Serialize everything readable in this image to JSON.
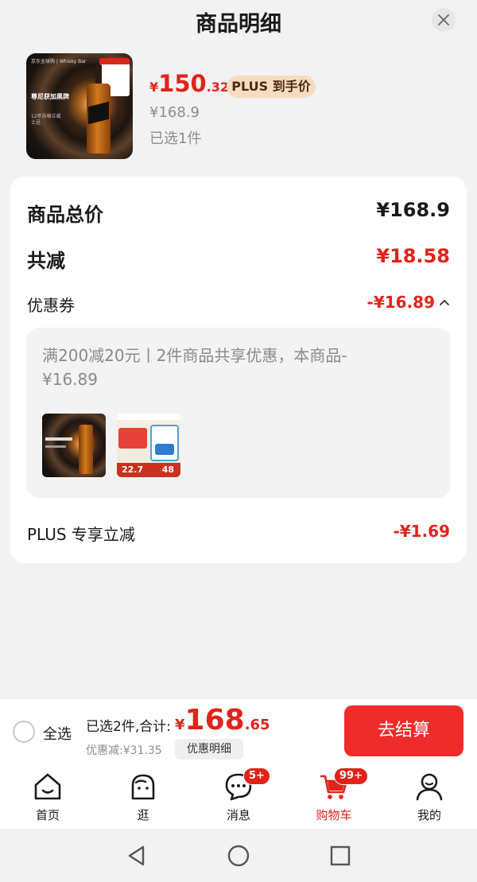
{
  "header": {
    "title": "商品明细",
    "close_icon": "close-icon"
  },
  "product": {
    "image": {
      "brand_text": "京东全球购 | Whisky Bar",
      "name_text": "尊尼获加黑牌",
      "sub_text": "12年苏格兰威士忌"
    },
    "price_currency": "¥",
    "price_int": "150",
    "price_dec": ".32",
    "plus_tag": "PLUS 到手价",
    "original_price": "¥168.9",
    "selected_count": "已选1件"
  },
  "summary": {
    "total_label": "商品总价",
    "total_value": "¥168.9",
    "reduce_label": "共减",
    "reduce_value": "¥18.58",
    "coupon_label": "优惠券",
    "coupon_value": "-¥16.89",
    "coupon_desc": "满200减20元丨2件商品共享优惠，本商品-¥16.89",
    "coupon_thumbs": [
      {
        "name": "whisky"
      },
      {
        "name": "milk-powder",
        "price_left": "22.7",
        "price_right": "48"
      }
    ],
    "plus_label": "PLUS 专享立减",
    "plus_value": "-¥1.69"
  },
  "checkout": {
    "select_all": "全选",
    "sum_prefix": "已选2件,合计:",
    "sum_currency": "¥",
    "sum_int": "168",
    "sum_dec": ".65",
    "discount_text": "优惠减:¥31.35",
    "discount_detail": "优惠明细",
    "checkout_button": "去结算"
  },
  "tabbar": {
    "items": [
      {
        "label": "首页",
        "icon": "home-icon"
      },
      {
        "label": "逛",
        "icon": "browse-icon"
      },
      {
        "label": "消息",
        "icon": "message-icon",
        "badge": "5+"
      },
      {
        "label": "购物车",
        "icon": "cart-icon",
        "badge": "99+",
        "active": true
      },
      {
        "label": "我的",
        "icon": "profile-icon"
      }
    ]
  },
  "colors": {
    "accent": "#e2231a",
    "plus_tag_bg": "#f8dcc0",
    "checkout_button": "#ef2b2b"
  }
}
